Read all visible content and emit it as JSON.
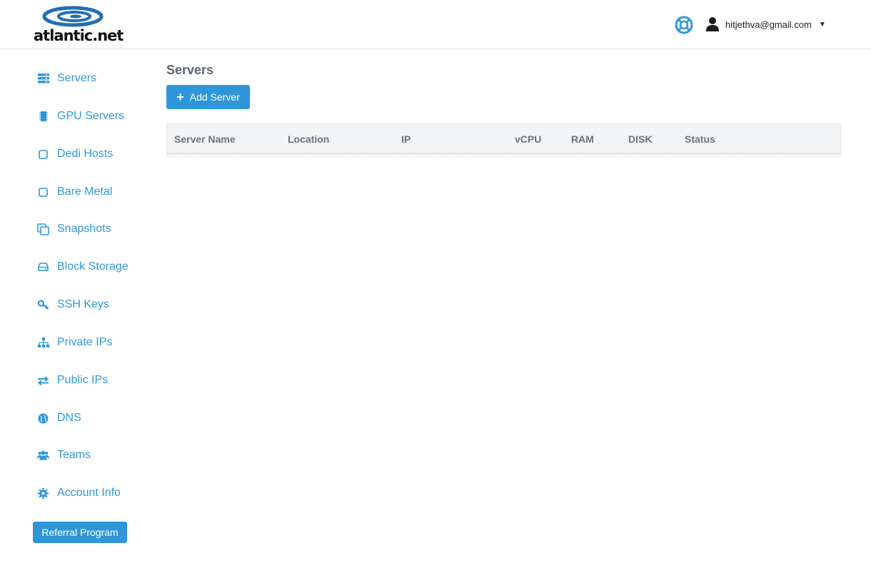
{
  "brand": {
    "logo_text": "atlantic.net"
  },
  "header": {
    "help_icon": "lifebuoy-icon",
    "user_email": "hitjethva@gmail.com",
    "caret": "▼"
  },
  "sidebar": {
    "items": [
      {
        "label": "Servers",
        "icon": "servers-icon"
      },
      {
        "label": "GPU Servers",
        "icon": "gpu-chip-icon"
      },
      {
        "label": "Dedi Hosts",
        "icon": "square-icon"
      },
      {
        "label": "Bare Metal",
        "icon": "square-icon"
      },
      {
        "label": "Snapshots",
        "icon": "copy-icon"
      },
      {
        "label": "Block Storage",
        "icon": "hard-drive-icon"
      },
      {
        "label": "SSH Keys",
        "icon": "key-icon"
      },
      {
        "label": "Private IPs",
        "icon": "sitemap-icon"
      },
      {
        "label": "Public IPs",
        "icon": "exchange-icon"
      },
      {
        "label": "DNS",
        "icon": "globe-icon"
      },
      {
        "label": "Teams",
        "icon": "users-icon"
      },
      {
        "label": "Account Info",
        "icon": "gear-icon"
      }
    ],
    "referral_label": "Referral Program"
  },
  "main": {
    "title": "Servers",
    "add_button_label": "Add Server",
    "table": {
      "columns": [
        "Server Name",
        "Location",
        "IP",
        "vCPU",
        "RAM",
        "DISK",
        "Status"
      ],
      "rows": []
    }
  },
  "colors": {
    "accent": "#2f97d9",
    "logo_blue": "#1f6fb5",
    "header_bg": "#f3f4f5"
  }
}
